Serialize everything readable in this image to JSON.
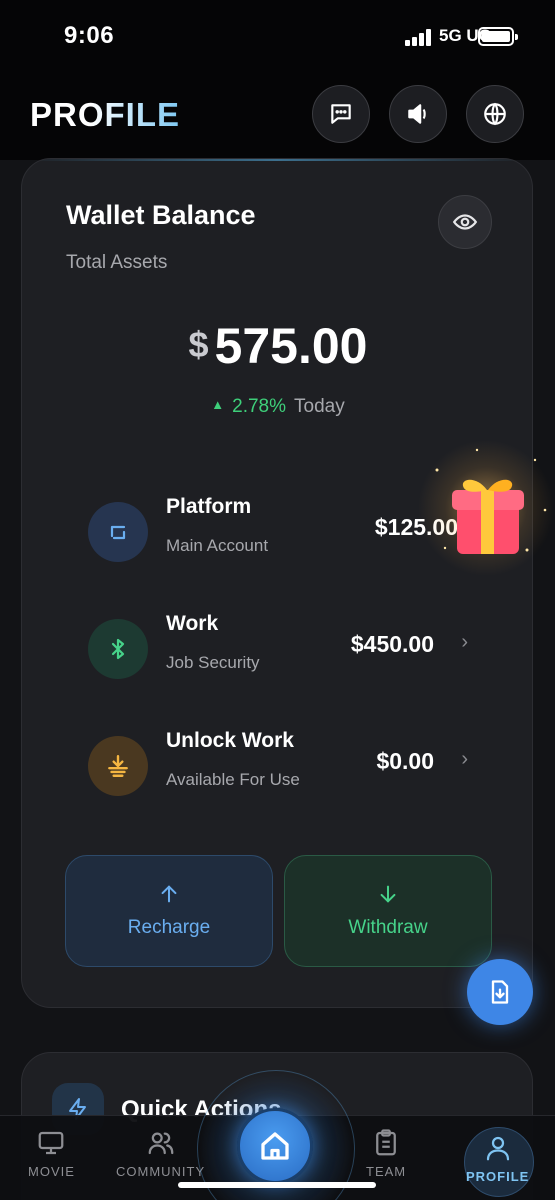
{
  "status_bar": {
    "time": "9:06",
    "network": "5G UC"
  },
  "header": {
    "title": "PROFILE"
  },
  "wallet": {
    "title": "Wallet Balance",
    "subtitle": "Total Assets",
    "currency_symbol": "$",
    "amount": "575.00",
    "change_percent": "2.78%",
    "change_label": "Today",
    "accounts": [
      {
        "name": "Platform",
        "description": "Main Account",
        "amount": "$125.00",
        "icon": "wallet-icon"
      },
      {
        "name": "Work",
        "description": "Job Security",
        "amount": "$450.00",
        "icon": "bluetooth-icon"
      },
      {
        "name": "Unlock Work",
        "description": "Available For Use",
        "amount": "$0.00",
        "icon": "download-tray-icon"
      }
    ],
    "recharge_label": "Recharge",
    "withdraw_label": "Withdraw"
  },
  "quick_actions": {
    "title": "Quick Actions"
  },
  "bottom_nav": {
    "items": [
      {
        "label": "MOVIE",
        "icon": "monitor-icon"
      },
      {
        "label": "COMMUNITY",
        "icon": "users-icon"
      },
      {
        "label": "",
        "icon": "home-icon"
      },
      {
        "label": "TEAM",
        "icon": "clipboard-icon"
      },
      {
        "label": "PROFILE",
        "icon": "user-icon"
      }
    ],
    "active": "PROFILE"
  },
  "colors": {
    "accent_blue": "#6aaef0",
    "accent_green": "#46d38a",
    "positive_change": "#3ecf7a",
    "background": "#121316",
    "card": "#1e1f23"
  }
}
